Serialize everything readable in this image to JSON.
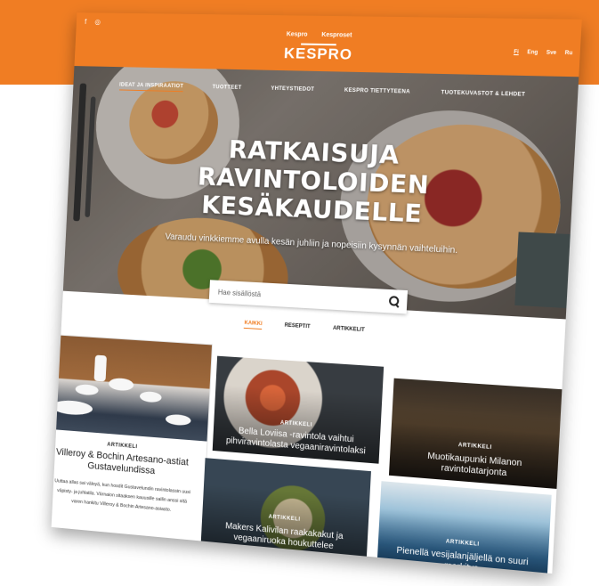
{
  "brand": {
    "logo": "KESPRO",
    "accent": "#f07d23"
  },
  "social": {
    "facebook": "f",
    "instagram": "◎"
  },
  "top_links": [
    "Kespro",
    "Kesproset"
  ],
  "languages": [
    "Fi",
    "Eng",
    "Sve",
    "Ru"
  ],
  "nav": [
    "IDEAT JA INSPIRAATIOT",
    "TUOTTEET",
    "YHTEYSTIEDOT",
    "KESPRO TIETTYTEENA",
    "TUOTEKUVASTOT & LEHDET"
  ],
  "hero": {
    "title_lines": [
      "RATKAISUJA",
      "RAVINTOLOIDEN",
      "KESÄKAUDELLE"
    ],
    "subtitle": "Varaudu vinkkiemme avulla kesän juhliin ja nopeisiin kysynnän vaihteluihin."
  },
  "search": {
    "placeholder": "Hae sisällöstä"
  },
  "filters": [
    "KAIKKI",
    "RESEPTIT",
    "ARTIKKELIT"
  ],
  "featured": {
    "category": "ARTIKKELI",
    "title": "Villeroy & Bochin Artesano-astiat Gustavelundissa",
    "description": "Uuttaa allas sai väloyä, kun hosdit Gustavelundin ravintolassin uusi väpisty- ja juhlatila. Värnaion sitaaksen kauusille sallin anssi sitä varen hankitu Villeroy & Bochin Artesano-asiasto."
  },
  "cards": [
    {
      "category": "ARTIKKELI",
      "title": "Bella Loviisa -ravintola vaihtui pihviravintolasta vegaaniravintolaksi"
    },
    {
      "category": "ARTIKKELI",
      "title": "Muotikaupunki Milanon ravintolatarjonta"
    },
    {
      "category": "ARTIKKELI",
      "title": "Makers Kalivilan raakakakut ja vegaaniruoka houkuttelee"
    },
    {
      "category": "ARTIKKELI",
      "title": "Pienellä vesijalanjäljellä on suuri merkitys"
    }
  ]
}
